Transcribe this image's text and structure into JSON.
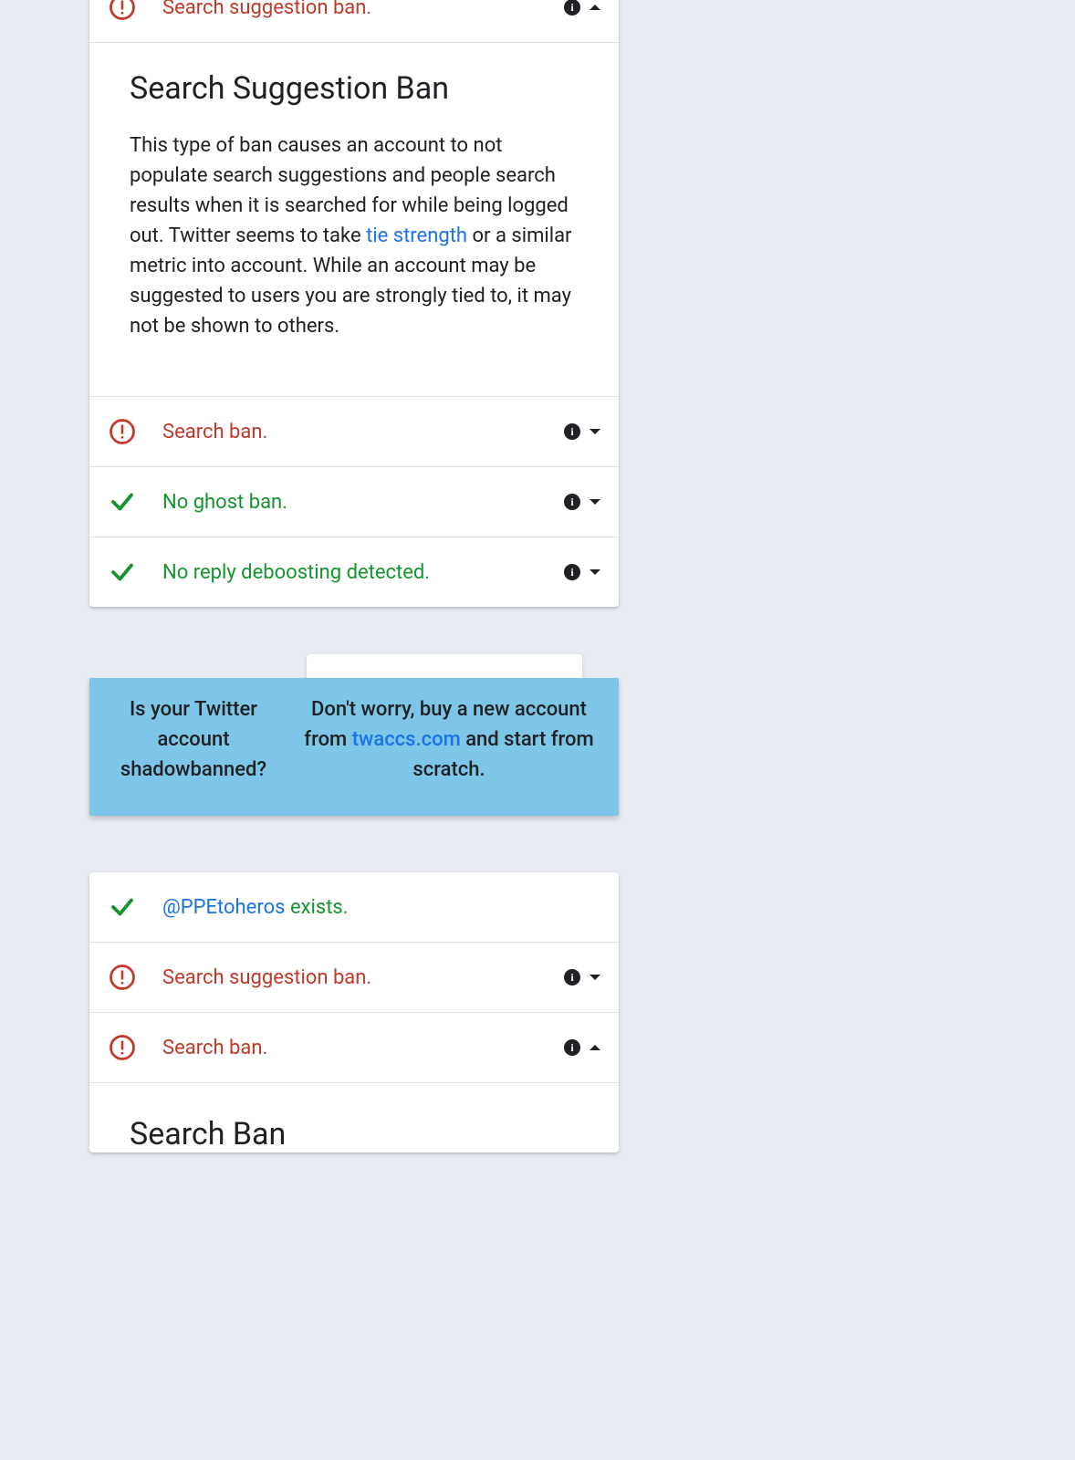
{
  "colors": {
    "red": "#c0392b",
    "green": "#15932f",
    "link": "#1a73e8",
    "banner_bg": "#7ec6e8",
    "page_bg": "#e8ecf2"
  },
  "card1": {
    "rows": [
      {
        "status": "alert",
        "label": "Search suggestion ban.",
        "color": "red",
        "caret": "up"
      },
      {
        "status": "alert",
        "label": "Search ban.",
        "color": "red",
        "caret": "down"
      },
      {
        "status": "check",
        "label": "No ghost ban.",
        "color": "green",
        "caret": "down"
      },
      {
        "status": "check",
        "label": "No reply deboosting detected.",
        "color": "green",
        "caret": "down"
      }
    ],
    "expanded": {
      "title": "Search Suggestion Ban",
      "body_before": "This type of ban causes an account to not populate search suggestions and people search results when it is searched for while being logged out. Twitter seems to take ",
      "link_text": "tie strength",
      "body_after": " or a similar metric into account. While an account may be suggested to users you are strongly tied to, it may not be shown to others."
    }
  },
  "banner": {
    "left": "Is your Twitter account shadowbanned?",
    "right_before": "Don't worry, buy a new account from ",
    "link_text": "twaccs.com",
    "right_after": " and start from scratch."
  },
  "card2": {
    "exists_row": {
      "handle": "@PPEtoheros",
      "suffix": " exists."
    },
    "rows": [
      {
        "status": "alert",
        "label": "Search suggestion ban.",
        "color": "red",
        "caret": "down"
      },
      {
        "status": "alert",
        "label": "Search ban.",
        "color": "red",
        "caret": "up"
      }
    ],
    "peek_title": "Search Ban"
  }
}
